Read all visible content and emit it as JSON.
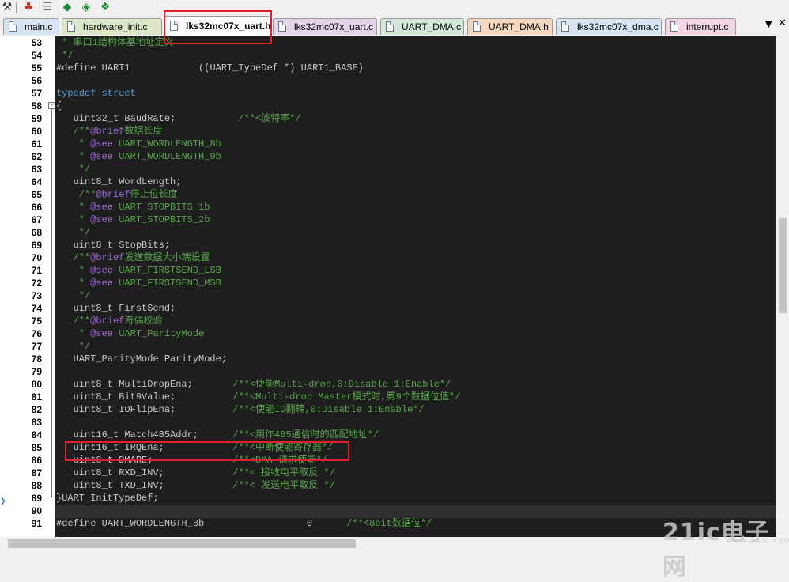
{
  "toolbar": {
    "icons": [
      "wrench-icon",
      "module-icon",
      "hierarchy-icon",
      "diamond-icon",
      "diamond-arrow-icon",
      "diamond-image-icon"
    ]
  },
  "tabs": [
    {
      "label": "main.c",
      "color": "#d7e4f2",
      "active": false
    },
    {
      "label": "hardware_init.c",
      "color": "#dbe8c8",
      "active": false
    },
    {
      "label": "lks32mc07x_uart.h",
      "color": "#ffffff",
      "active": true
    },
    {
      "label": "lks32mc07x_uart.c",
      "color": "#e3d4ea",
      "active": false
    },
    {
      "label": "UART_DMA.c",
      "color": "#d3e8d9",
      "active": false
    },
    {
      "label": "UART_DMA.h",
      "color": "#f7d8bf",
      "active": false
    },
    {
      "label": "lks32mc07x_dma.c",
      "color": "#d7e4f2",
      "active": false
    },
    {
      "label": "interrupt.c",
      "color": "#f3d6e3",
      "active": false
    }
  ],
  "tab_overflow": "▼",
  "lines": [
    {
      "n": "53",
      "segs": [
        [
          " * 串口1结构体基地址定义",
          "cm"
        ]
      ]
    },
    {
      "n": "54",
      "segs": [
        [
          " */",
          "cm"
        ]
      ]
    },
    {
      "n": "55",
      "segs": [
        [
          "#define",
          "pp"
        ],
        [
          " UART1            ((UART_TypeDef *) UART1_BASE)",
          "pp"
        ]
      ]
    },
    {
      "n": "56",
      "segs": []
    },
    {
      "n": "57",
      "segs": [
        [
          "typedef struct",
          "kw"
        ]
      ]
    },
    {
      "n": "58",
      "segs": [
        [
          "{",
          "pp"
        ]
      ]
    },
    {
      "n": "59",
      "segs": [
        [
          "   uint32_t BaudRate;           ",
          "pp"
        ],
        [
          "/**<波特率*/",
          "cm"
        ]
      ]
    },
    {
      "n": "60",
      "segs": [
        [
          "   /**",
          "cm"
        ],
        [
          "@brief",
          "tag"
        ],
        [
          "数据长度",
          "cm"
        ]
      ]
    },
    {
      "n": "61",
      "segs": [
        [
          "    * ",
          "cm"
        ],
        [
          "@see",
          "tag"
        ],
        [
          " UART_WORDLENGTH_8b",
          "cm"
        ]
      ]
    },
    {
      "n": "62",
      "segs": [
        [
          "    * ",
          "cm"
        ],
        [
          "@see",
          "tag"
        ],
        [
          " UART_WORDLENGTH_9b",
          "cm"
        ]
      ]
    },
    {
      "n": "63",
      "segs": [
        [
          "    */",
          "cm"
        ]
      ]
    },
    {
      "n": "64",
      "segs": [
        [
          "   uint8_t WordLength;",
          "pp"
        ]
      ]
    },
    {
      "n": "65",
      "segs": [
        [
          "    /**",
          "cm"
        ],
        [
          "@brief",
          "tag"
        ],
        [
          "停止位长度",
          "cm"
        ]
      ]
    },
    {
      "n": "66",
      "segs": [
        [
          "    * ",
          "cm"
        ],
        [
          "@see",
          "tag"
        ],
        [
          " UART_STOPBITS_1b",
          "cm"
        ]
      ]
    },
    {
      "n": "67",
      "segs": [
        [
          "    * ",
          "cm"
        ],
        [
          "@see",
          "tag"
        ],
        [
          " UART_STOPBITS_2b",
          "cm"
        ]
      ]
    },
    {
      "n": "68",
      "segs": [
        [
          "    */",
          "cm"
        ]
      ]
    },
    {
      "n": "69",
      "segs": [
        [
          "   uint8_t StopBits;",
          "pp"
        ]
      ]
    },
    {
      "n": "70",
      "segs": [
        [
          "   /**",
          "cm"
        ],
        [
          "@brief",
          "tag"
        ],
        [
          "发送数据大小端设置",
          "cm"
        ]
      ]
    },
    {
      "n": "71",
      "segs": [
        [
          "    * ",
          "cm"
        ],
        [
          "@see",
          "tag"
        ],
        [
          " UART_FIRSTSEND_LSB",
          "cm"
        ]
      ]
    },
    {
      "n": "72",
      "segs": [
        [
          "    * ",
          "cm"
        ],
        [
          "@see",
          "tag"
        ],
        [
          " UART_FIRSTSEND_MSB",
          "cm"
        ]
      ]
    },
    {
      "n": "73",
      "segs": [
        [
          "    */",
          "cm"
        ]
      ]
    },
    {
      "n": "74",
      "segs": [
        [
          "   uint8_t FirstSend;",
          "pp"
        ]
      ]
    },
    {
      "n": "75",
      "segs": [
        [
          "   /**",
          "cm"
        ],
        [
          "@brief",
          "tag"
        ],
        [
          "奇偶校验",
          "cm"
        ]
      ]
    },
    {
      "n": "76",
      "segs": [
        [
          "    * ",
          "cm"
        ],
        [
          "@see",
          "tag"
        ],
        [
          " UART_ParityMode",
          "cm"
        ]
      ]
    },
    {
      "n": "77",
      "segs": [
        [
          "    */",
          "cm"
        ]
      ]
    },
    {
      "n": "78",
      "segs": [
        [
          "   UART_ParityMode ParityMode;",
          "pp"
        ]
      ]
    },
    {
      "n": "79",
      "segs": []
    },
    {
      "n": "80",
      "segs": [
        [
          "   uint8_t MultiDropEna;       ",
          "pp"
        ],
        [
          "/**<使能Multi-drop,0:Disable 1:Enable*/",
          "cm"
        ]
      ]
    },
    {
      "n": "81",
      "segs": [
        [
          "   uint8_t Bit9Value;          ",
          "pp"
        ],
        [
          "/**<Multi-drop Master模式时,第9个数据位值*/",
          "cm"
        ]
      ]
    },
    {
      "n": "82",
      "segs": [
        [
          "   uint8_t IOFlipEna;          ",
          "pp"
        ],
        [
          "/**<使能IO翻转,0:Disable 1:Enable*/",
          "cm"
        ]
      ]
    },
    {
      "n": "83",
      "segs": []
    },
    {
      "n": "84",
      "segs": [
        [
          "   uint16_t Match485Addr;      ",
          "pp"
        ],
        [
          "/**<用作485通信时的匹配地址*/",
          "cm"
        ]
      ]
    },
    {
      "n": "85",
      "segs": [
        [
          "   uint16_t IRQEna;            ",
          "pp"
        ],
        [
          "/**<中断使能寄存器*/",
          "cm"
        ]
      ]
    },
    {
      "n": "86",
      "segs": [
        [
          "   uint8_t DMARE;              ",
          "pp"
        ],
        [
          "/**<DMA 请求使能*/",
          "cm"
        ]
      ]
    },
    {
      "n": "87",
      "segs": [
        [
          "   uint8_t RXD_INV;            ",
          "pp"
        ],
        [
          "/**< 接收电平取反 */",
          "cm"
        ]
      ]
    },
    {
      "n": "88",
      "segs": [
        [
          "   uint8_t TXD_INV;            ",
          "pp"
        ],
        [
          "/**< 发送电平取反 */",
          "cm"
        ]
      ]
    },
    {
      "n": "89",
      "segs": [
        [
          "}UART_InitTypeDef;",
          "pp"
        ]
      ]
    },
    {
      "n": "90",
      "segs": []
    },
    {
      "n": "91",
      "segs": [
        [
          "#define",
          "pp"
        ],
        [
          " UART_WORDLENGTH_8b                  0      ",
          "pp"
        ],
        [
          "/**<8bit数据位*/",
          "cm"
        ]
      ]
    }
  ],
  "watermark": {
    "main": "21ic电子网",
    "sub": "www.21ic.com"
  }
}
